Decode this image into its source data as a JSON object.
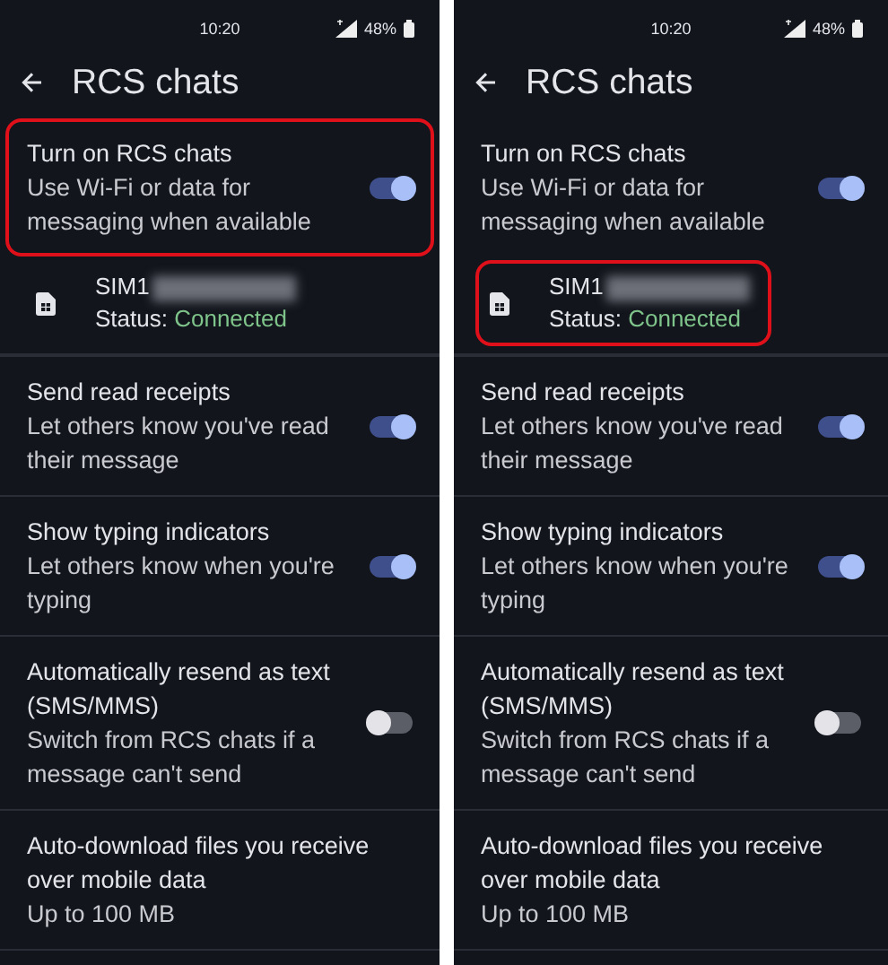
{
  "screens": [
    {
      "status_bar": {
        "time": "10:20",
        "battery": "48%"
      },
      "title": "RCS chats",
      "settings": [
        {
          "kind": "toggle",
          "title": "Turn on RCS chats",
          "summary": "Use Wi-Fi or data for messaging when available",
          "on": true,
          "highlighted": true
        },
        {
          "kind": "sim",
          "name": "SIM1",
          "status_label": "Status:",
          "status_value": "Connected",
          "highlighted": false
        },
        {
          "kind": "toggle",
          "title": "Send read receipts",
          "summary": "Let others know you've read their message",
          "on": true,
          "highlighted": false
        },
        {
          "kind": "toggle",
          "title": "Show typing indicators",
          "summary": "Let others know when you're typing",
          "on": true,
          "highlighted": false
        },
        {
          "kind": "toggle",
          "title": "Automatically resend as text (SMS/MMS)",
          "summary": "Switch from RCS chats if a message can't send",
          "on": false,
          "highlighted": false
        },
        {
          "kind": "text",
          "title": "Auto-download files you receive over mobile data",
          "summary": "Up to 100 MB",
          "highlighted": false
        }
      ]
    },
    {
      "status_bar": {
        "time": "10:20",
        "battery": "48%"
      },
      "title": "RCS chats",
      "settings": [
        {
          "kind": "toggle",
          "title": "Turn on RCS chats",
          "summary": "Use Wi-Fi or data for messaging when available",
          "on": true,
          "highlighted": false
        },
        {
          "kind": "sim",
          "name": "SIM1",
          "status_label": "Status:",
          "status_value": "Connected",
          "highlighted": true
        },
        {
          "kind": "toggle",
          "title": "Send read receipts",
          "summary": "Let others know you've read their message",
          "on": true,
          "highlighted": false
        },
        {
          "kind": "toggle",
          "title": "Show typing indicators",
          "summary": "Let others know when you're typing",
          "on": true,
          "highlighted": false
        },
        {
          "kind": "toggle",
          "title": "Automatically resend as text (SMS/MMS)",
          "summary": "Switch from RCS chats if a message can't send",
          "on": false,
          "highlighted": false
        },
        {
          "kind": "text",
          "title": "Auto-download files you receive over mobile data",
          "summary": "Up to 100 MB",
          "highlighted": false
        }
      ]
    }
  ]
}
